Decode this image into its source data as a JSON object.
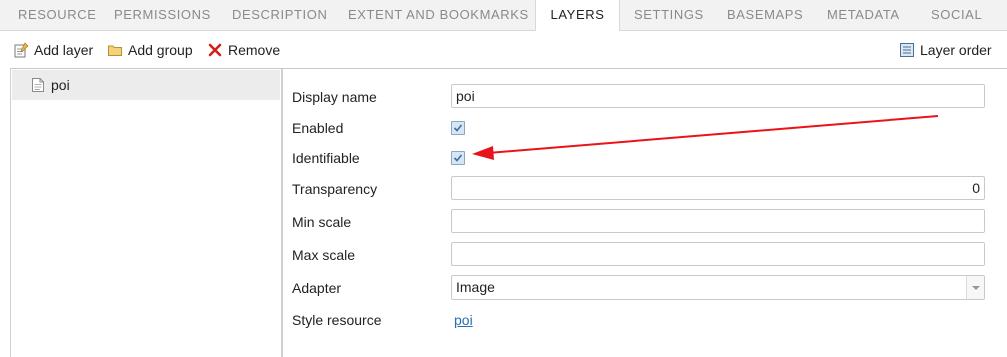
{
  "tabs": [
    {
      "label": "Resource"
    },
    {
      "label": "Permissions"
    },
    {
      "label": "Description"
    },
    {
      "label": "Extent and bookmarks"
    },
    {
      "label": "Layers",
      "active": true
    },
    {
      "label": "Settings"
    },
    {
      "label": "Basemaps"
    },
    {
      "label": "Metadata"
    },
    {
      "label": "Social"
    }
  ],
  "toolbar": {
    "add_layer": "Add layer",
    "add_group": "Add group",
    "remove": "Remove",
    "layer_order": "Layer order"
  },
  "tree": {
    "items": [
      {
        "label": "poi",
        "icon": "document-icon",
        "selected": true
      }
    ]
  },
  "form": {
    "display_name": {
      "label": "Display name",
      "value": "poi"
    },
    "enabled": {
      "label": "Enabled",
      "checked": true
    },
    "identifiable": {
      "label": "Identifiable",
      "checked": true
    },
    "transparency": {
      "label": "Transparency",
      "value": "0"
    },
    "min_scale": {
      "label": "Min scale",
      "value": ""
    },
    "max_scale": {
      "label": "Max scale",
      "value": ""
    },
    "adapter": {
      "label": "Adapter",
      "value": "Image"
    },
    "style_resource": {
      "label": "Style resource",
      "value": "poi"
    }
  },
  "colors": {
    "annotation_arrow": "#e8141a",
    "link": "#2a6fb0",
    "remove_icon": "#d0201e",
    "folder_icon": "#e8c45a"
  }
}
